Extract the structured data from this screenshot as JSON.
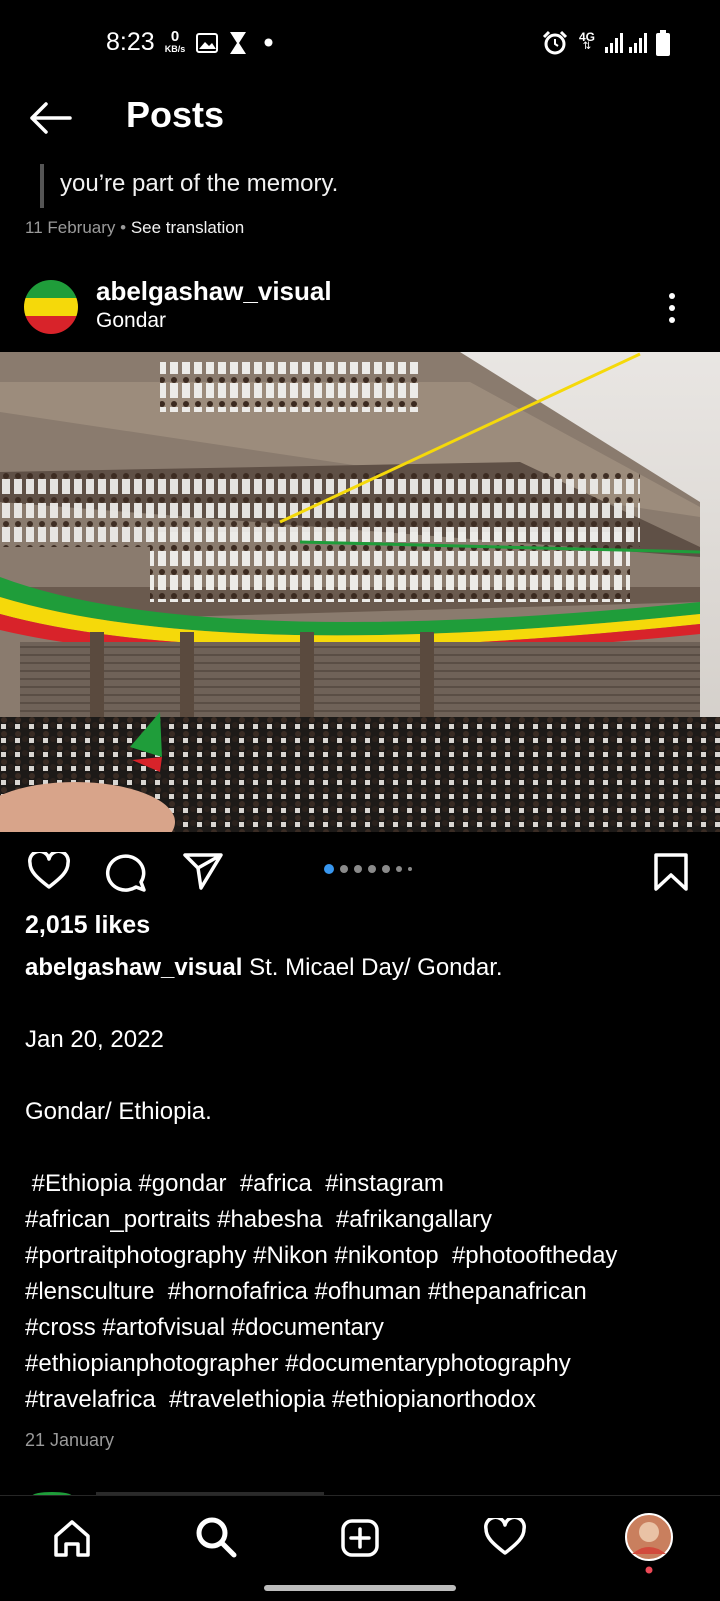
{
  "status_bar": {
    "time": "8:23",
    "net_speed_value": "0",
    "net_speed_unit": "KB/s",
    "network_type": "4G",
    "icons": [
      "gallery-icon",
      "hourglass-icon",
      "dot-icon",
      "alarm-icon",
      "signal-icon",
      "signal-icon",
      "battery-icon"
    ]
  },
  "header": {
    "title": "Posts",
    "back_icon": "arrow-left-icon"
  },
  "previous_post": {
    "caption_tail": "you’re part of the memory.",
    "date": "11 February",
    "separator": " • ",
    "translate_label": "See translation"
  },
  "post": {
    "username": "abelgashaw_visual",
    "location": "Gondar",
    "carousel": {
      "count": 7,
      "active_index": 0
    },
    "likes": "2,015 likes",
    "caption_username": "abelgashaw_visual",
    "caption_text": " St. Micael Day/ Gondar.\n\nJan 20, 2022\n\nGondar/ Ethiopia.\n\n #Ethiopia #gondar  #africa  #instagram\n#african_portraits #habesha  #afrikangallary\n#portraitphotography #Nikon #nikontop  #photooftheday\n#lensculture  #hornofafrica #ofhuman #thepanafrican\n#cross #artofvisual #documentary\n#ethiopianphotographer #documentaryphotography\n#travelafrica  #travelethiopia #ethiopianorthodox",
    "date": "21 January"
  },
  "bottom_nav": {
    "items": [
      "home-icon",
      "search-icon",
      "create-post-icon",
      "activity-heart-icon",
      "profile-avatar"
    ],
    "profile_badge_color": "#ed4956"
  },
  "colors": {
    "accent": "#3897f0",
    "background": "#000000",
    "muted": "#9a9a9a"
  }
}
